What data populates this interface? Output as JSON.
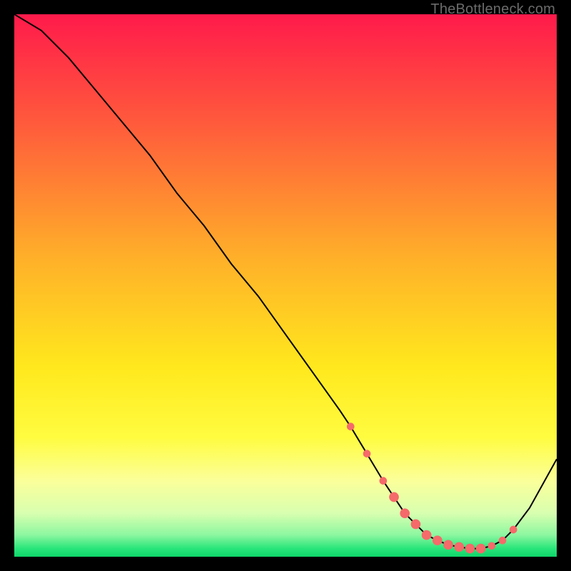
{
  "watermark": "TheBottleneck.com",
  "colors": {
    "bg": "#000000",
    "curve": "#000000",
    "marker": "#f56a6a",
    "gradient_stops": [
      {
        "offset": 0.0,
        "color": "#ff1a4b"
      },
      {
        "offset": 0.2,
        "color": "#ff5a3c"
      },
      {
        "offset": 0.45,
        "color": "#ffb029"
      },
      {
        "offset": 0.65,
        "color": "#ffe81d"
      },
      {
        "offset": 0.78,
        "color": "#fffc40"
      },
      {
        "offset": 0.86,
        "color": "#fbff9a"
      },
      {
        "offset": 0.92,
        "color": "#d8ffb0"
      },
      {
        "offset": 0.96,
        "color": "#8cf7a0"
      },
      {
        "offset": 0.985,
        "color": "#28e57a"
      },
      {
        "offset": 1.0,
        "color": "#0fd66a"
      }
    ]
  },
  "chart_data": {
    "type": "line",
    "title": "",
    "xlabel": "",
    "ylabel": "",
    "xlim": [
      0,
      100
    ],
    "ylim": [
      0,
      100
    ],
    "grid": false,
    "legend": false,
    "series": [
      {
        "name": "curve",
        "x": [
          0,
          5,
          10,
          15,
          20,
          25,
          30,
          35,
          40,
          45,
          50,
          55,
          60,
          62,
          65,
          68,
          70,
          72,
          74,
          76,
          78,
          80,
          82,
          84,
          86,
          88,
          90,
          92,
          95,
          100
        ],
        "y": [
          100,
          97,
          92,
          86,
          80,
          74,
          67,
          61,
          54,
          48,
          41,
          34,
          27,
          24,
          19,
          14,
          11,
          8,
          6,
          4,
          3,
          2.2,
          1.8,
          1.5,
          1.5,
          2,
          3,
          5,
          9,
          18
        ]
      }
    ],
    "markers": [
      {
        "x": 62,
        "y": 24,
        "r": 0.7
      },
      {
        "x": 65,
        "y": 19,
        "r": 0.7
      },
      {
        "x": 68,
        "y": 14,
        "r": 0.7
      },
      {
        "x": 70,
        "y": 11,
        "r": 0.9
      },
      {
        "x": 72,
        "y": 8,
        "r": 0.9
      },
      {
        "x": 74,
        "y": 6,
        "r": 0.9
      },
      {
        "x": 76,
        "y": 4,
        "r": 0.9
      },
      {
        "x": 78,
        "y": 3,
        "r": 0.9
      },
      {
        "x": 80,
        "y": 2.2,
        "r": 0.9
      },
      {
        "x": 82,
        "y": 1.8,
        "r": 0.9
      },
      {
        "x": 84,
        "y": 1.5,
        "r": 0.9
      },
      {
        "x": 86,
        "y": 1.5,
        "r": 0.9
      },
      {
        "x": 88,
        "y": 2,
        "r": 0.7
      },
      {
        "x": 90,
        "y": 3,
        "r": 0.7
      },
      {
        "x": 92,
        "y": 5,
        "r": 0.7
      }
    ]
  }
}
